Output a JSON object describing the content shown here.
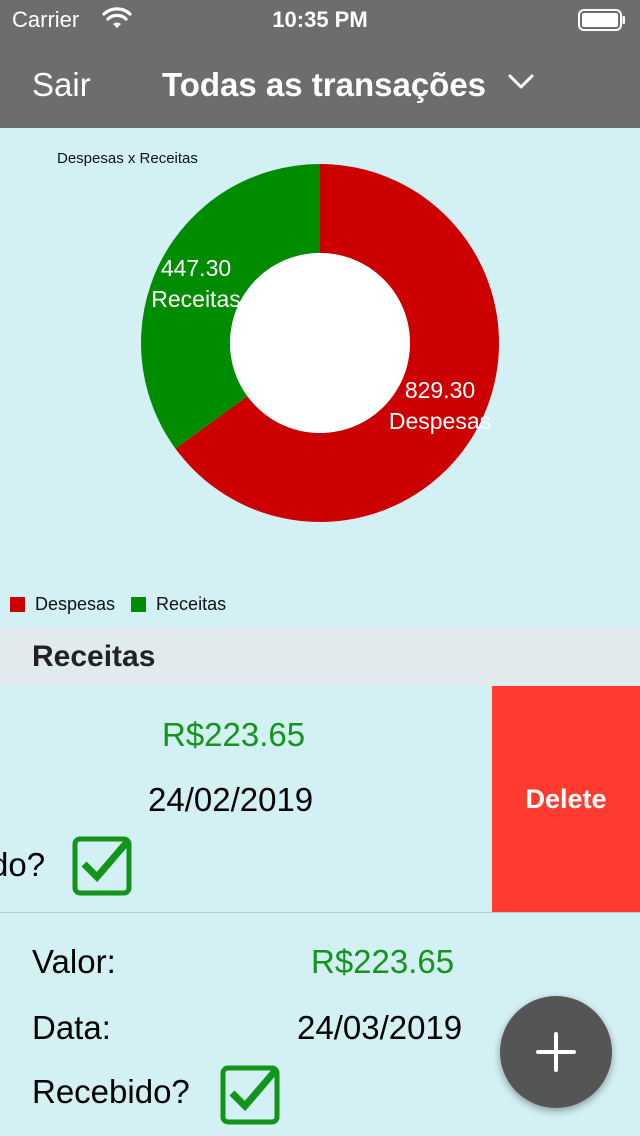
{
  "status_bar": {
    "carrier": "Carrier",
    "time": "10:35 PM",
    "wifi_icon": "wifi-icon",
    "battery_icon": "battery-icon"
  },
  "nav": {
    "left_button": "Sair",
    "title": "Todas as transações",
    "title_icon": "chevron-down-icon",
    "color": "#6d6d6d"
  },
  "chart_data": {
    "type": "pie",
    "title": "Despesas x Receitas",
    "donut": true,
    "labels": [
      "Despesas",
      "Receitas"
    ],
    "values": [
      829.3,
      447.3
    ],
    "value_labels": [
      "829.30",
      "447.30"
    ],
    "colors": [
      "#cc0000",
      "#008c00"
    ],
    "legend": [
      "Despesas",
      "Receitas"
    ],
    "legend_position": "bottom-left"
  },
  "section": {
    "title": "Receitas"
  },
  "rows": [
    {
      "value": "R$223.65",
      "date": "24/02/2019",
      "received_label": "Recebido?",
      "received_label_visible": "do?",
      "received": true,
      "delete_label": "Delete"
    },
    {
      "value_label": "Valor:",
      "value": "R$223.65",
      "date_label": "Data:",
      "date": "24/03/2019",
      "received_label": "Recebido?",
      "received": true
    }
  ],
  "fab": {
    "icon": "plus-icon"
  },
  "colors": {
    "background": "#d3f0f4",
    "income": "#12951a",
    "delete": "#ff3b30",
    "checkbox": "#12951a"
  }
}
